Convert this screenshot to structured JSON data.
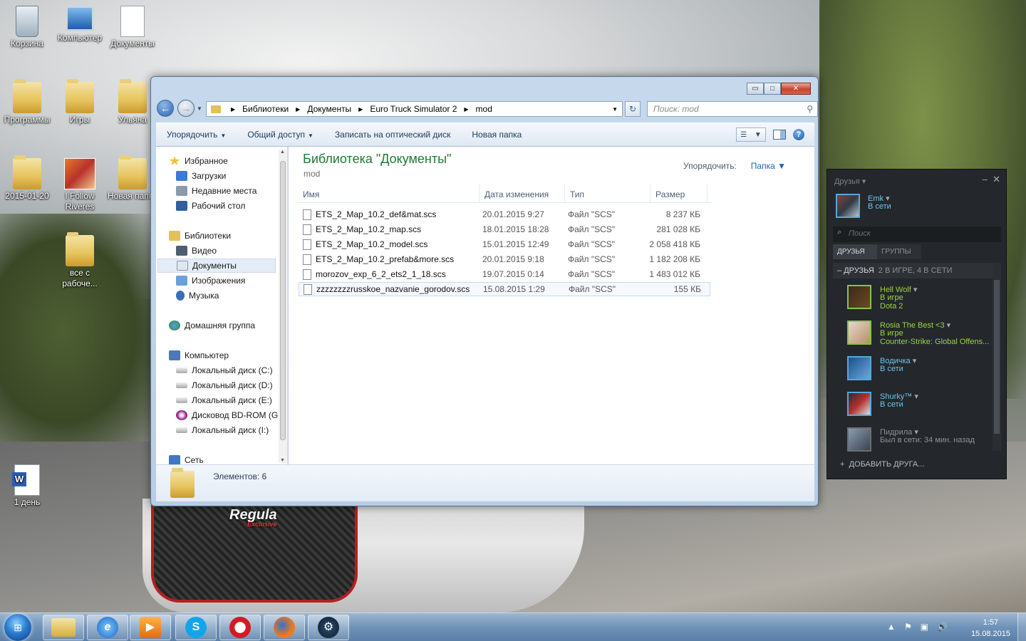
{
  "desktop": {
    "icons": [
      {
        "label": "Корзина"
      },
      {
        "label": "Компьютер"
      },
      {
        "label": "Документы"
      },
      {
        "label": "Программы"
      },
      {
        "label": "Игры"
      },
      {
        "label": "Ульяна"
      },
      {
        "label": "2015-01-20"
      },
      {
        "label": "I Follow Riveres"
      },
      {
        "label": "Новая папка"
      },
      {
        "label": "все с рабоче..."
      },
      {
        "label": "1 день"
      }
    ],
    "car_logo": "Regula",
    "car_logo_sub": "Exclusive"
  },
  "explorer": {
    "window_buttons": {
      "minimize": "▭",
      "maximize": "□",
      "close": "✕"
    },
    "address": {
      "crumbs": [
        "Библиотеки",
        "Документы",
        "Euro Truck Simulator 2",
        "mod"
      ]
    },
    "search": {
      "placeholder": "Поиск: mod"
    },
    "toolbar": {
      "organize": "Упорядочить",
      "share": "Общий доступ",
      "burn": "Записать на оптический диск",
      "new_folder": "Новая папка"
    },
    "nav": {
      "favorites": "Избранное",
      "downloads": "Загрузки",
      "recent": "Недавние места",
      "desktop": "Рабочий стол",
      "libraries": "Библиотеки",
      "video": "Видео",
      "documents": "Документы",
      "images": "Изображения",
      "music": "Музыка",
      "homegroup": "Домашняя группа",
      "computer": "Компьютер",
      "disk_c": "Локальный диск (C:)",
      "disk_d": "Локальный диск (D:)",
      "disk_e": "Локальный диск  (E:)",
      "bdrom": "Дисковод BD-ROM (G",
      "disk_i": "Локальный диск (I:)",
      "network": "Сеть"
    },
    "library": {
      "title": "Библиотека \"Документы\"",
      "subtitle": "mod",
      "arrange_label": "Упорядочить:",
      "arrange_value": "Папка"
    },
    "columns": {
      "name": "Имя",
      "date": "Дата изменения",
      "type": "Тип",
      "size": "Размер"
    },
    "files": [
      {
        "name": "ETS_2_Map_10.2_def&mat.scs",
        "date": "20.01.2015 9:27",
        "type": "Файл \"SCS\"",
        "size": "8 237 КБ"
      },
      {
        "name": "ETS_2_Map_10.2_map.scs",
        "date": "18.01.2015 18:28",
        "type": "Файл \"SCS\"",
        "size": "281 028 КБ"
      },
      {
        "name": "ETS_2_Map_10.2_model.scs",
        "date": "15.01.2015 12:49",
        "type": "Файл \"SCS\"",
        "size": "2 058 418 КБ"
      },
      {
        "name": "ETS_2_Map_10.2_prefab&more.scs",
        "date": "20.01.2015 9:18",
        "type": "Файл \"SCS\"",
        "size": "1 182 208 КБ"
      },
      {
        "name": "morozov_exp_6_2_ets2_1_18.scs",
        "date": "19.07.2015 0:14",
        "type": "Файл \"SCS\"",
        "size": "1 483 012 КБ"
      },
      {
        "name": "zzzzzzzzrusskoe_nazvanie_gorodov.scs",
        "date": "15.08.2015 1:29",
        "type": "Файл \"SCS\"",
        "size": "155 КБ"
      }
    ],
    "status": "Элементов: 6"
  },
  "steam": {
    "header": "Друзья",
    "me": {
      "name": "Emk",
      "status": "В сети"
    },
    "search_placeholder": "Поиск",
    "tabs": {
      "friends": "ДРУЗЬЯ",
      "groups": "ГРУППЫ"
    },
    "group_title": "ДРУЗЬЯ",
    "group_counts": "2 В ИГРЕ, 4 В СЕТИ",
    "friends": [
      {
        "name": "Hell Wolf",
        "status": "В игре",
        "game": "Dota 2"
      },
      {
        "name": "Rosia The Best  <3",
        "status": "В игре",
        "game": "Counter-Strike: Global Offens..."
      },
      {
        "name": "Водичка",
        "status": "В сети"
      },
      {
        "name": "Shurky™",
        "status": "В сети"
      },
      {
        "name": "Пидрила",
        "status": "Был в сети: 34 мин. назад"
      }
    ],
    "add_friend": "ДОБАВИТЬ ДРУГА..."
  },
  "taskbar": {
    "start_label": "⊞",
    "apps": [
      "Проводник",
      "Internet Explorer",
      "Media Player",
      "Skype",
      "Opera",
      "Firefox",
      "Steam"
    ],
    "tray": {
      "up": "▲",
      "icons": [
        "⚑",
        "▣",
        "🔊"
      ]
    },
    "time": "1:57",
    "date": "15.08.2015"
  }
}
